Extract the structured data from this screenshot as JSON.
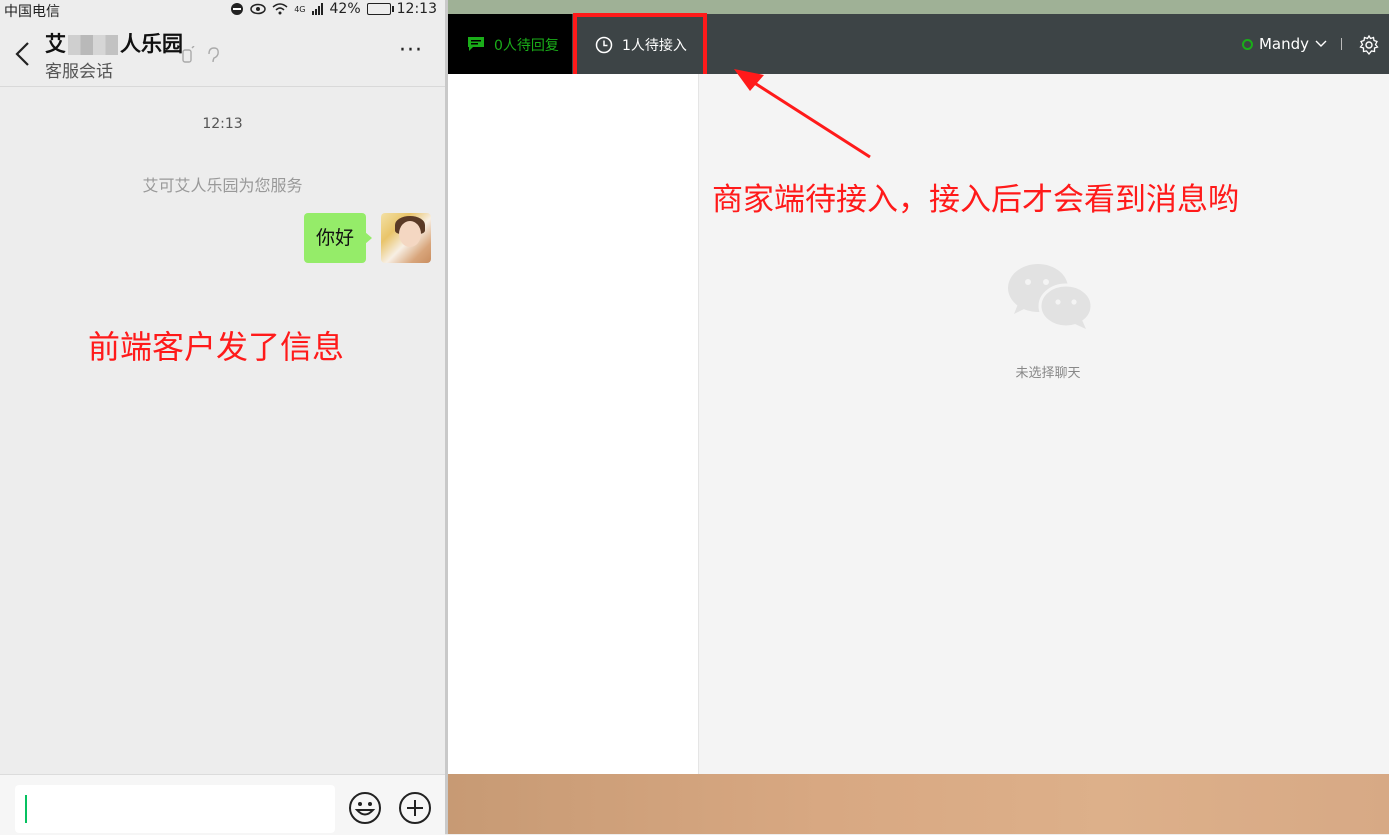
{
  "status_bar": {
    "carrier": "中国电信",
    "signal": "4G",
    "battery": "42%",
    "time": "12:13"
  },
  "chat": {
    "title_prefix": "艾",
    "title_suffix": "人乐园",
    "subtitle": "客服会话",
    "more": "···",
    "messages": {
      "time": "12:13",
      "system": "艾可艾人乐园为您服务",
      "user_text": "你好"
    },
    "annotation": "前端客户发了信息"
  },
  "web": {
    "tab_reply_label": "0人待回复",
    "tab_wait_label": "1人待接入",
    "user_name": "Mandy",
    "empty_text": "未选择聊天",
    "annotation": "商家端待接入，接入后才会看到消息哟",
    "colors": {
      "accent": "#1aad19",
      "annotation": "#ff1a1a",
      "header": "#3d4446"
    }
  }
}
